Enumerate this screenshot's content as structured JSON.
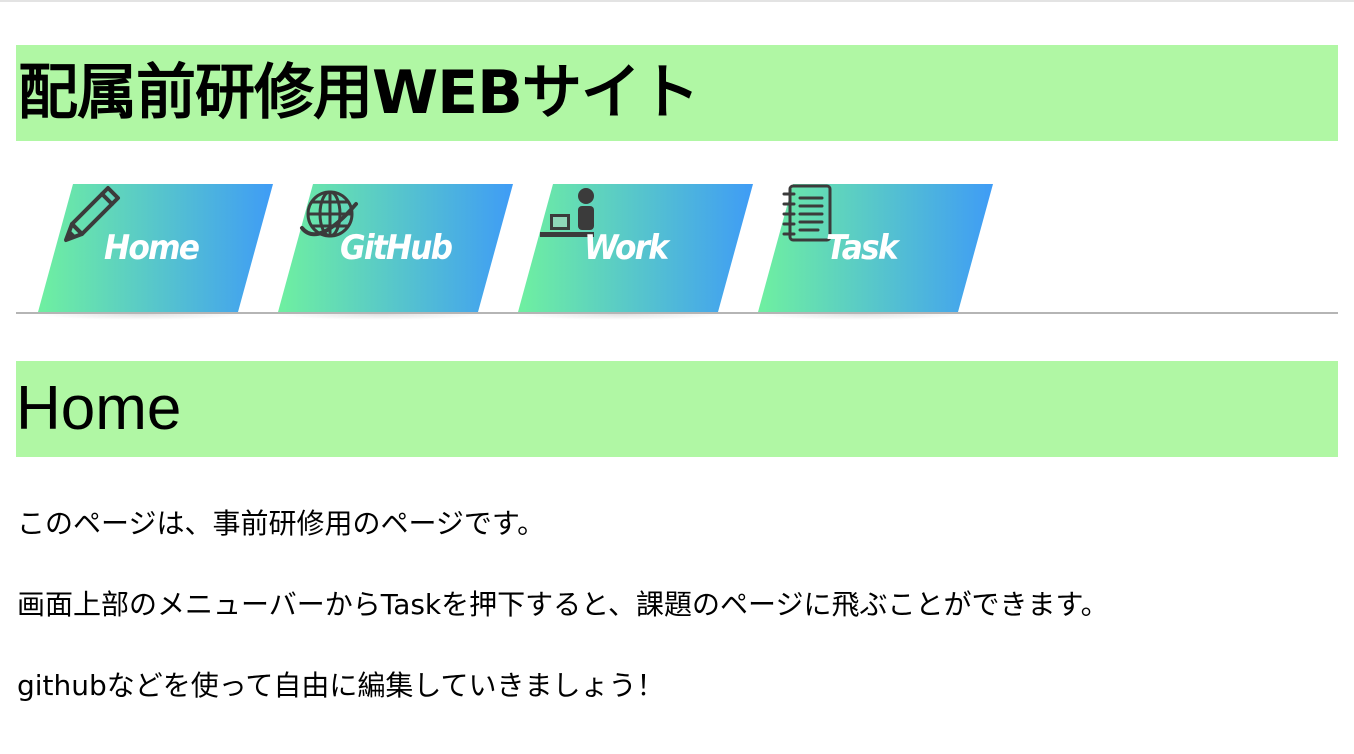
{
  "header": {
    "title": "配属前研修用WEBサイト"
  },
  "nav": {
    "items": [
      {
        "label": "Home",
        "icon": "pencil-icon"
      },
      {
        "label": "GitHub",
        "icon": "globe-icon"
      },
      {
        "label": "Work",
        "icon": "person-at-desk-icon"
      },
      {
        "label": "Task",
        "icon": "notepad-icon"
      }
    ]
  },
  "section": {
    "title": "Home"
  },
  "content": {
    "paragraphs": [
      "このページは、事前研修用のページです。",
      "画面上部のメニューバーからTaskを押下すると、課題のページに飛ぶことができます。",
      "githubなどを使って自由に編集していきましょう！"
    ]
  },
  "colors": {
    "header_bg": "#b0f7a4",
    "tab_gradient_start": "#6ff0a0",
    "tab_gradient_end": "#3f9cf6",
    "icon_color": "#3b3b3b"
  }
}
